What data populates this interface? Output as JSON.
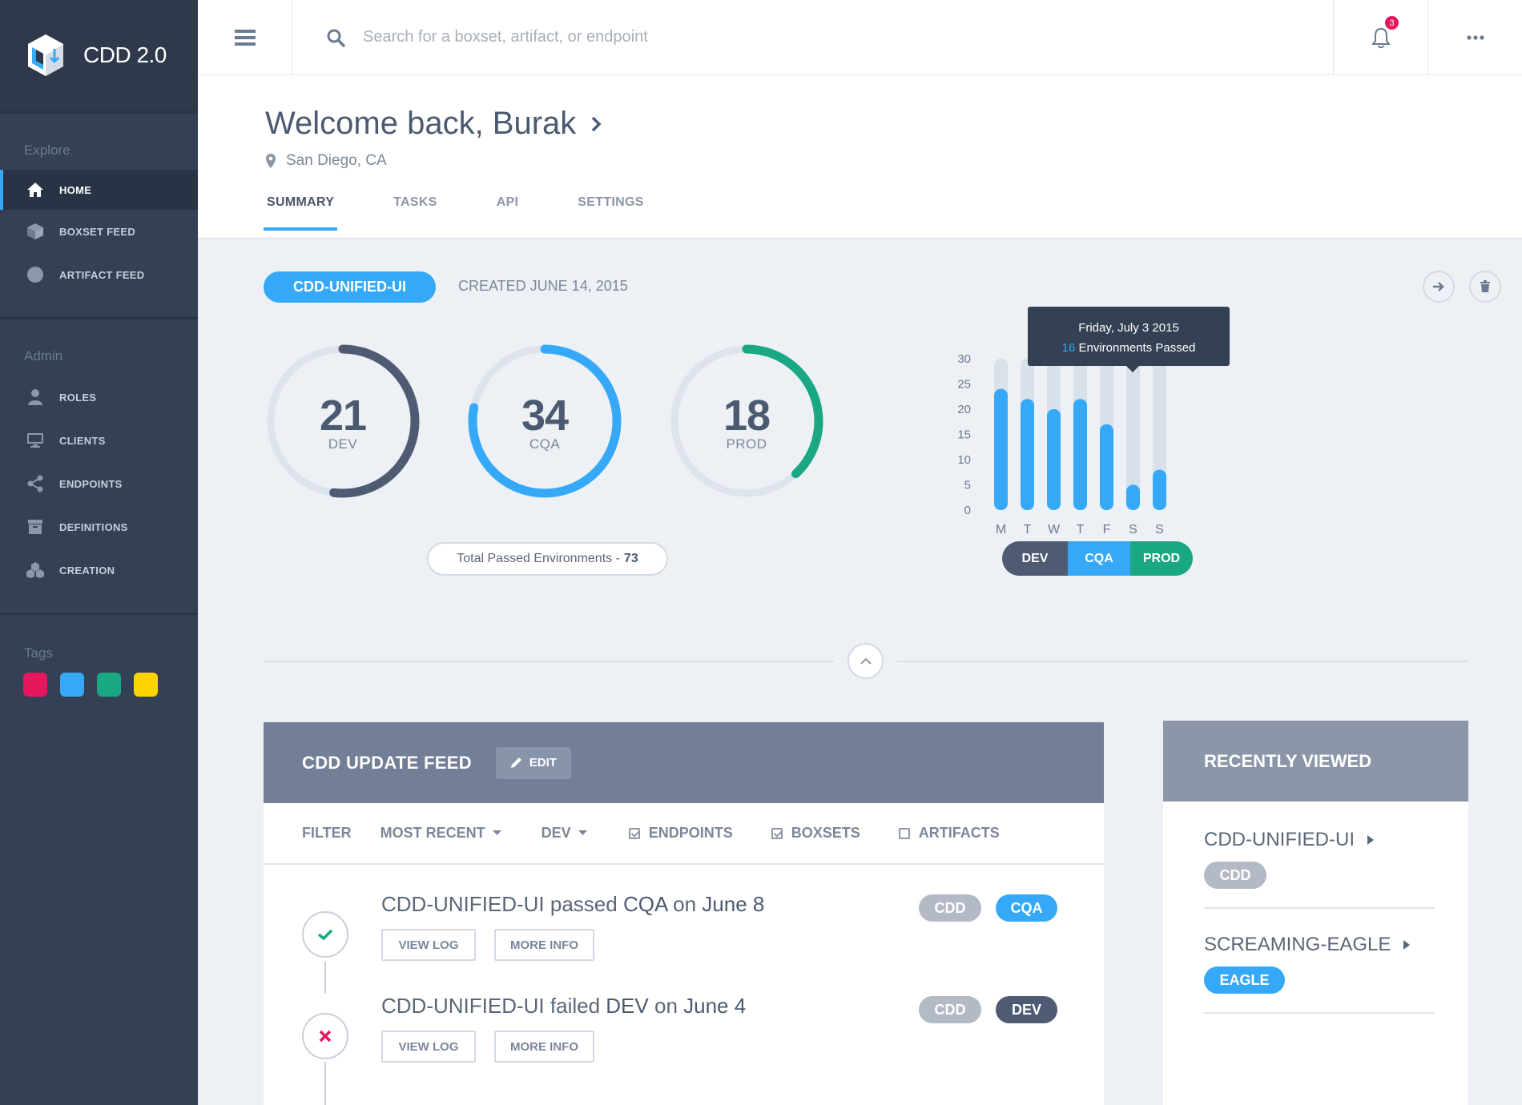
{
  "brand": {
    "name": "CDD 2.0"
  },
  "sidebar": {
    "explore_title": "Explore",
    "explore_items": [
      {
        "label": "HOME",
        "icon": "home-icon",
        "active": true
      },
      {
        "label": "BOXSET FEED",
        "icon": "box-icon"
      },
      {
        "label": "ARTIFACT FEED",
        "icon": "circle-icon"
      }
    ],
    "admin_title": "Admin",
    "admin_items": [
      {
        "label": "ROLES",
        "icon": "user-icon"
      },
      {
        "label": "CLIENTS",
        "icon": "monitor-icon"
      },
      {
        "label": "ENDPOINTS",
        "icon": "share-icon"
      },
      {
        "label": "DEFINITIONS",
        "icon": "archive-icon"
      },
      {
        "label": "CREATION",
        "icon": "cubes-icon"
      }
    ],
    "tags_title": "Tags",
    "tag_colors": [
      "#e6175c",
      "#35a9f8",
      "#1aa882",
      "#ffd200"
    ]
  },
  "topbar": {
    "search_placeholder": "Search for a boxset, artifact, or endpoint",
    "notification_count": "3"
  },
  "header": {
    "welcome": "Welcome back, Burak",
    "location": "San Diego, CA",
    "tabs": [
      {
        "label": "SUMMARY",
        "active": true
      },
      {
        "label": "TASKS"
      },
      {
        "label": "API"
      },
      {
        "label": "SETTINGS"
      }
    ]
  },
  "summary": {
    "boxset": "CDD-UNIFIED-UI",
    "created": "CREATED JUNE 14, 2015",
    "gauges": [
      {
        "value": "21",
        "label": "DEV",
        "fraction": 0.52,
        "color": "#4f5b72"
      },
      {
        "value": "34",
        "label": "CQA",
        "fraction": 0.78,
        "color": "#35a9f8"
      },
      {
        "value": "18",
        "label": "PROD",
        "fraction": 0.38,
        "color": "#1aa882"
      }
    ],
    "total_label": "Total Passed Environments -",
    "total_value": "73",
    "tooltip": {
      "date": "Friday, July 3 2015",
      "count": "16",
      "text": "Environments Passed"
    },
    "env_toggle": [
      {
        "label": "DEV",
        "color": "#4f5b72"
      },
      {
        "label": "CQA",
        "color": "#35a9f8"
      },
      {
        "label": "PROD",
        "color": "#1aa882"
      }
    ]
  },
  "chart_data": {
    "type": "bar",
    "categories": [
      "M",
      "T",
      "W",
      "T",
      "F",
      "S",
      "S"
    ],
    "values": [
      24,
      22,
      20,
      22,
      17,
      5,
      8
    ],
    "ylim": [
      0,
      30
    ],
    "yticks": [
      30,
      25,
      20,
      15,
      10,
      5,
      0
    ],
    "bar_color": "#35a9f8",
    "track_color": "#d8e0e9",
    "grid": false
  },
  "feed": {
    "title": "CDD UPDATE FEED",
    "edit_label": "EDIT",
    "filter": {
      "label": "FILTER",
      "sort": "MOST RECENT",
      "env": "DEV",
      "checks": [
        {
          "label": "ENDPOINTS",
          "checked": true
        },
        {
          "label": "BOXSETS",
          "checked": true
        },
        {
          "label": "ARTIFACTS",
          "checked": false
        }
      ]
    },
    "entries": [
      {
        "status": "passed",
        "boxset": "CDD-UNIFIED-UI",
        "verb": "passed",
        "env": "CQA",
        "on": "on",
        "date": "June 8",
        "view_log": "VIEW LOG",
        "more_info": "MORE INFO",
        "tags": [
          {
            "label": "CDD",
            "color": "#b3bac5"
          },
          {
            "label": "CQA",
            "color": "#35a9f8"
          }
        ]
      },
      {
        "status": "failed",
        "boxset": "CDD-UNIFIED-UI",
        "verb": "failed",
        "env": "DEV",
        "on": "on",
        "date": "June 4",
        "view_log": "VIEW LOG",
        "more_info": "MORE INFO",
        "tags": [
          {
            "label": "CDD",
            "color": "#b3bac5"
          },
          {
            "label": "DEV",
            "color": "#4f5b72"
          }
        ]
      }
    ]
  },
  "recent": {
    "title": "RECENTLY VIEWED",
    "items": [
      {
        "name": "CDD-UNIFIED-UI",
        "tag": "CDD",
        "tag_color": "#b3bac5"
      },
      {
        "name": "SCREAMING-EAGLE",
        "tag": "EAGLE",
        "tag_color": "#35a9f8"
      }
    ]
  }
}
